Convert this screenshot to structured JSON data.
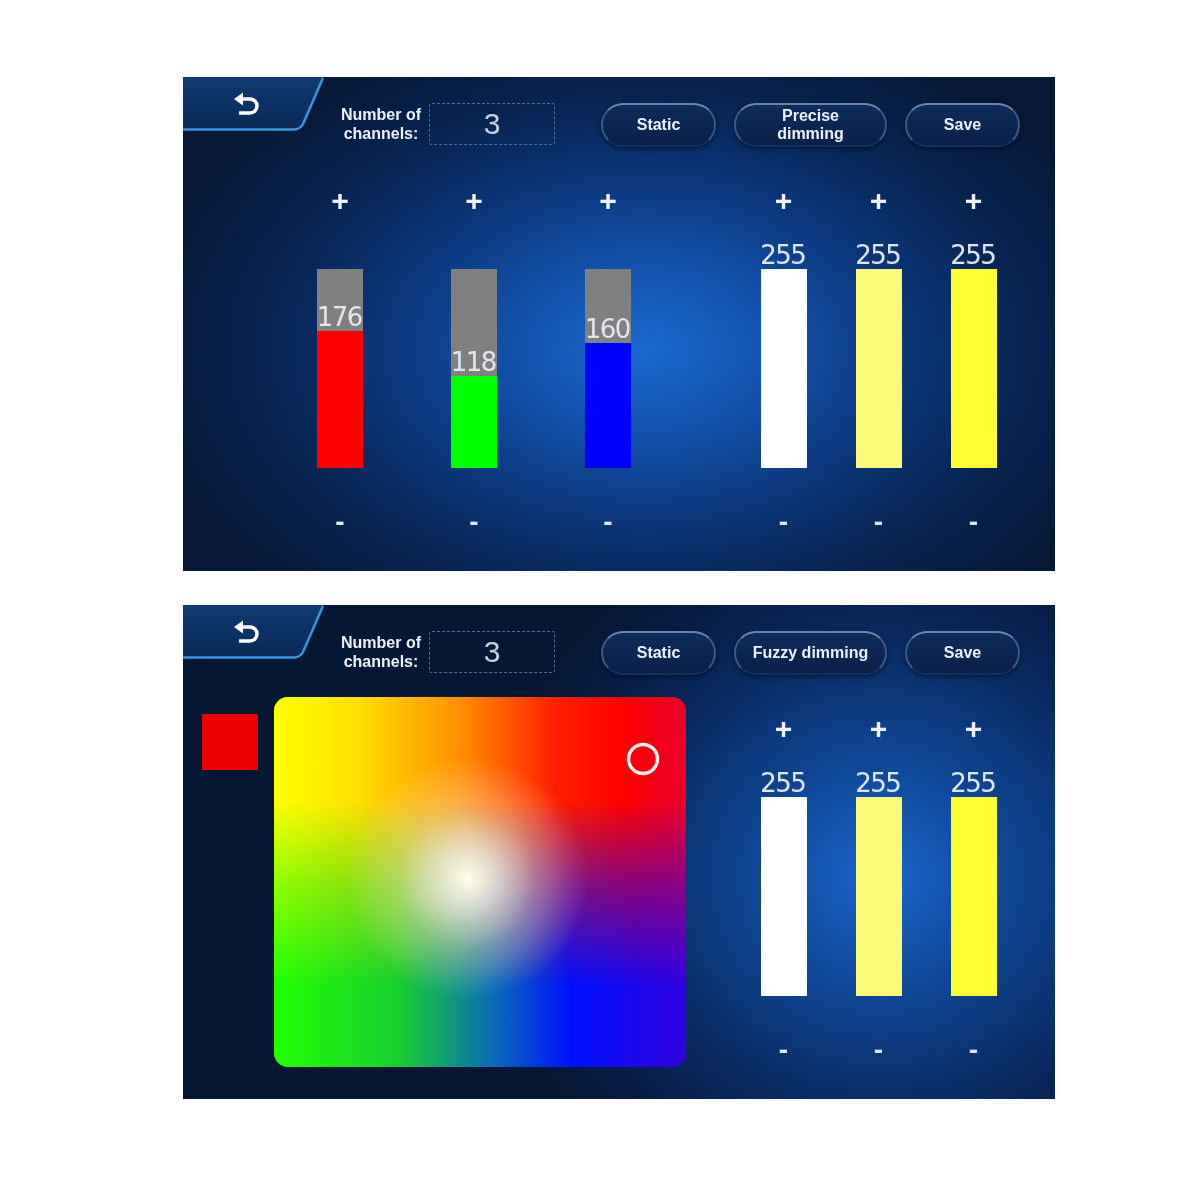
{
  "panels": [
    {
      "channel_count": {
        "label": "Number of channels:",
        "value": "3"
      },
      "buttons": [
        {
          "label": "Static"
        },
        {
          "label": "Precise\ndimming"
        },
        {
          "label": "Save"
        }
      ],
      "rgb_channels": [
        {
          "plus": "+",
          "reading": "176",
          "level": 0.69,
          "color": "#ff0000",
          "minus": "-"
        },
        {
          "plus": "+",
          "reading": "118",
          "level": 0.46,
          "color": "#00ff00",
          "minus": "-"
        },
        {
          "plus": "+",
          "reading": "160",
          "level": 0.63,
          "color": "#0000ff",
          "minus": "-"
        }
      ],
      "white_channels": [
        {
          "plus": "+",
          "reading": "255",
          "level": 1,
          "color": "#ffffff",
          "minus": "-"
        },
        {
          "plus": "+",
          "reading": "255",
          "level": 1,
          "color": "#fafa78",
          "minus": "-"
        },
        {
          "plus": "+",
          "reading": "255",
          "level": 1,
          "color": "#ffff33",
          "minus": "-"
        }
      ]
    },
    {
      "channel_count": {
        "label": "Number of channels:",
        "value": "3"
      },
      "buttons": [
        {
          "label": "Static"
        },
        {
          "label": "Fuzzy dimming"
        },
        {
          "label": "Save"
        }
      ],
      "color_picker": {
        "color": "#ee0000"
      },
      "white_channels": [
        {
          "plus": "+",
          "reading": "255",
          "level": 1,
          "color": "#ffffff",
          "minus": "-"
        },
        {
          "plus": "+",
          "reading": "255",
          "level": 1,
          "color": "#fafa78",
          "minus": "-"
        },
        {
          "plus": "+",
          "reading": "255",
          "level": 1,
          "color": "#ffff33",
          "minus": "-"
        }
      ]
    }
  ]
}
